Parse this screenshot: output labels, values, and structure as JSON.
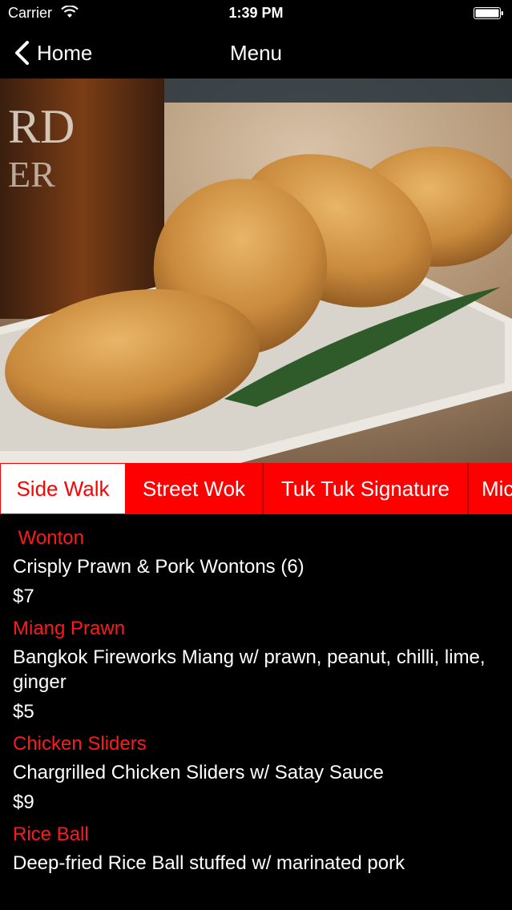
{
  "status_bar": {
    "carrier": "Carrier",
    "time": "1:39 PM"
  },
  "nav": {
    "back_label": "Home",
    "title": "Menu"
  },
  "hero": {
    "image": "fried-rice-balls-photo"
  },
  "tabs": [
    {
      "label": "Side Walk",
      "active": true
    },
    {
      "label": "Street Wok"
    },
    {
      "label": "Tuk Tuk Signature"
    },
    {
      "label": "Mic"
    }
  ],
  "menu_items": [
    {
      "name": " Wonton",
      "description": "Crisply Prawn & Pork Wontons (6)",
      "price": "$7"
    },
    {
      "name": "Miang Prawn",
      "description": "Bangkok Fireworks Miang w/ prawn, peanut, chilli, lime, ginger",
      "price": "$5"
    },
    {
      "name": "Chicken Sliders",
      "description": "Chargrilled Chicken Sliders w/ Satay Sauce",
      "price": "$9"
    },
    {
      "name": "Rice Ball",
      "description": "Deep-fried Rice Ball stuffed w/ marinated pork",
      "price": ""
    }
  ],
  "colors": {
    "accent": "#ff0000",
    "background": "#000000"
  }
}
